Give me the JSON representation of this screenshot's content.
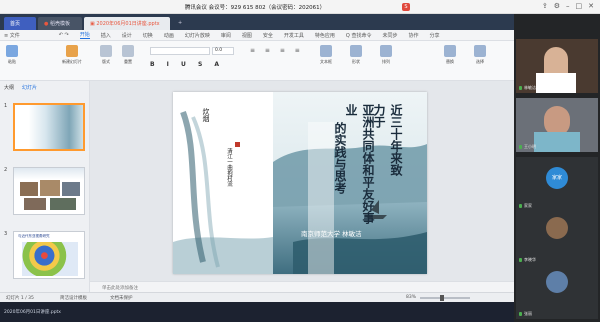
{
  "meeting": {
    "title": "腾讯会议 会议号：929 615 802（会议密码：202061）"
  },
  "wps": {
    "tabs": [
      {
        "label": "首页"
      },
      {
        "label": "稻壳模板"
      },
      {
        "label": "2020年06月01日讲座.pptx"
      }
    ],
    "menu": [
      {
        "label": "≡ 文件"
      },
      {
        "label": "开始"
      },
      {
        "label": "插入"
      },
      {
        "label": "设计"
      },
      {
        "label": "切换"
      },
      {
        "label": "动画"
      },
      {
        "label": "幻灯片放映"
      },
      {
        "label": "审阅"
      },
      {
        "label": "视图"
      },
      {
        "label": "安全"
      },
      {
        "label": "开发工具"
      },
      {
        "label": "特色应用"
      },
      {
        "label": "Q 查找命令"
      }
    ],
    "menu_right": [
      "未同步",
      "协作",
      "分享"
    ],
    "user": "admin",
    "ribbon": {
      "font_size": "0.0"
    },
    "ribbon_buttons": [
      "粘贴",
      "新建幻灯片",
      "版式",
      "重置",
      "节",
      "文本框",
      "形状",
      "排列",
      "替换",
      "选择"
    ],
    "side_tabs": [
      "大纲",
      "幻灯片"
    ],
    "slide_numbers": [
      "1",
      "2",
      "3"
    ],
    "slide": {
      "title_col1": "近三十年来致力于",
      "title_col2": "亚洲共同体和平友好事业",
      "title_col3": "的实践与思考",
      "author": "南京师范大学 林敏洁",
      "callig_1": "炊烟",
      "callig_2": "清江一曲抱村流"
    },
    "thumb3_title": "与近代东亚视角研究",
    "notes_placeholder": "单击此处添加备注",
    "status": {
      "slide_info": "幻灯片 1 / 35",
      "theme": "简洁设计模板",
      "doc_state": "文档未保护",
      "zoom": "83%"
    },
    "taskbar": {
      "item": "2020年06月01日讲座.pptx"
    }
  },
  "participants": [
    {
      "name": "林敏洁",
      "accent": "#3a2e28"
    },
    {
      "name": "王小明",
      "accent": "#6b7078"
    },
    {
      "name": "家家",
      "accent": "#2f8bd6"
    },
    {
      "name": "李晓华",
      "accent": "#4b3a2f"
    },
    {
      "name": "张丽",
      "accent": "#5e7fa8"
    }
  ],
  "colors": {
    "accent": "#1f6fde",
    "meeting_red": "#e0483c",
    "thumb_highlight": "#ff9a2e"
  }
}
